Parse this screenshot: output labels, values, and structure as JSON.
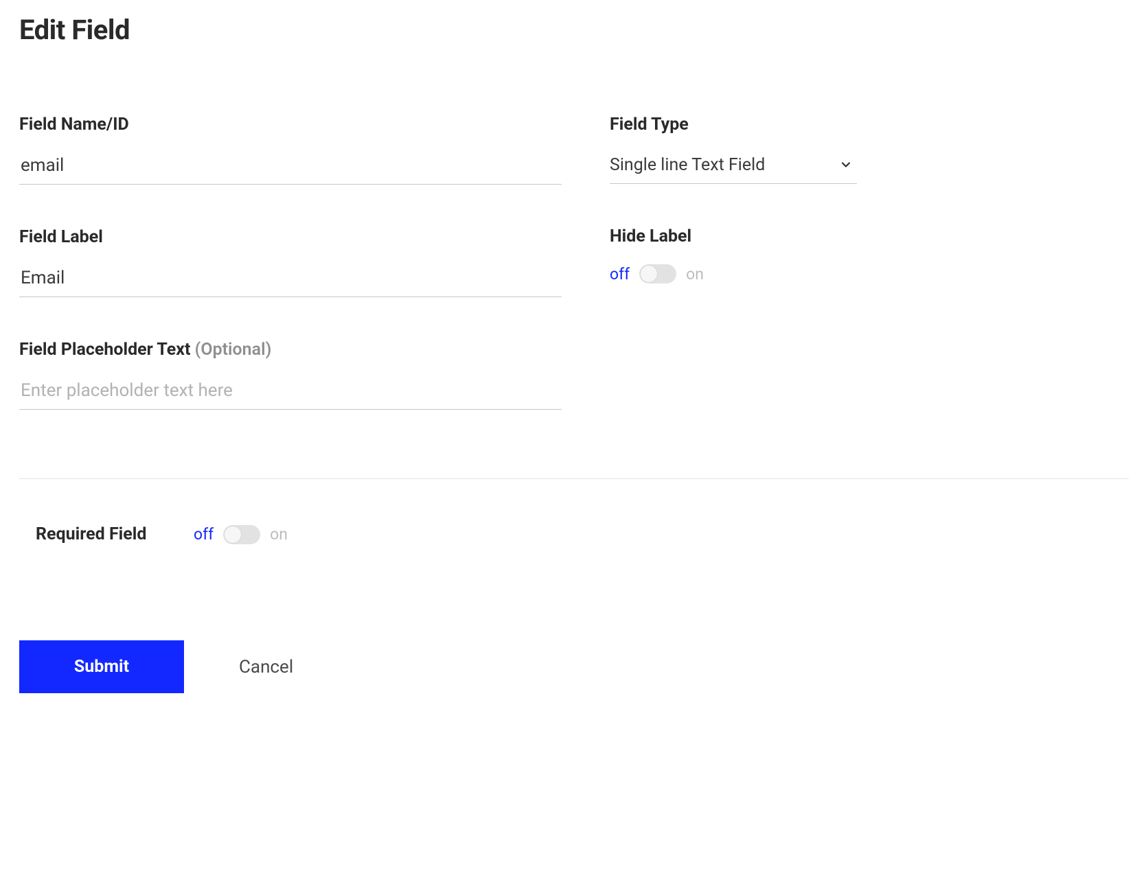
{
  "page": {
    "title": "Edit Field"
  },
  "fields": {
    "name_id": {
      "label": "Field Name/ID",
      "value": "email"
    },
    "type": {
      "label": "Field Type",
      "value": "Single line Text Field"
    },
    "field_label": {
      "label": "Field Label",
      "value": "Email"
    },
    "hide_label": {
      "label": "Hide Label",
      "off": "off",
      "on": "on"
    },
    "placeholder": {
      "label": "Field Placeholder Text ",
      "optional": "(Optional)",
      "placeholder_text": "Enter placeholder text here",
      "value": ""
    },
    "required": {
      "label": "Required Field",
      "off": "off",
      "on": "on"
    }
  },
  "buttons": {
    "submit": "Submit",
    "cancel": "Cancel"
  }
}
